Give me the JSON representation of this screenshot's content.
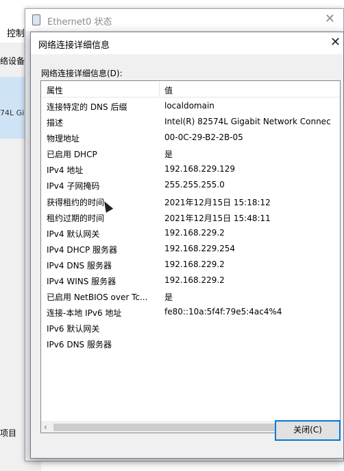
{
  "background_window": {
    "menu_label": "控制",
    "devices_label": "络设备",
    "adapter_label": "74L Gi",
    "items_label": "项目"
  },
  "status_window": {
    "title": "Ethernet0 状态",
    "close_glyph": "✕"
  },
  "dialog": {
    "title": "网络连接详细信息",
    "close_glyph": "✕",
    "group_label": "网络连接详细信息(D):",
    "columns": [
      "属性",
      "值"
    ],
    "rows": [
      {
        "prop": "连接特定的 DNS 后缀",
        "val": "localdomain"
      },
      {
        "prop": "描述",
        "val": "Intel(R) 82574L Gigabit Network Connec"
      },
      {
        "prop": "物理地址",
        "val": "00-0C-29-B2-2B-05"
      },
      {
        "prop": "已启用 DHCP",
        "val": "是"
      },
      {
        "prop": "IPv4 地址",
        "val": "192.168.229.129"
      },
      {
        "prop": "IPv4 子网掩码",
        "val": "255.255.255.0"
      },
      {
        "prop": "获得租约的时间",
        "val": "2021年12月15日 15:18:12"
      },
      {
        "prop": "租约过期的时间",
        "val": "2021年12月15日 15:48:11"
      },
      {
        "prop": "IPv4 默认网关",
        "val": "192.168.229.2"
      },
      {
        "prop": "IPv4 DHCP 服务器",
        "val": "192.168.229.254"
      },
      {
        "prop": "IPv4 DNS 服务器",
        "val": "192.168.229.2"
      },
      {
        "prop": "IPv4 WINS 服务器",
        "val": "192.168.229.2"
      },
      {
        "prop": "已启用 NetBIOS over Tc...",
        "val": "是"
      },
      {
        "prop": "连接-本地 IPv6 地址",
        "val": "fe80::10a:5f4f:79e5:4ac4%4"
      },
      {
        "prop": "IPv6 默认网关",
        "val": ""
      },
      {
        "prop": "IPv6 DNS 服务器",
        "val": ""
      }
    ],
    "scroll_left_glyph": "‹",
    "scroll_right_glyph": "›",
    "close_button_label": "关闭(C)"
  }
}
